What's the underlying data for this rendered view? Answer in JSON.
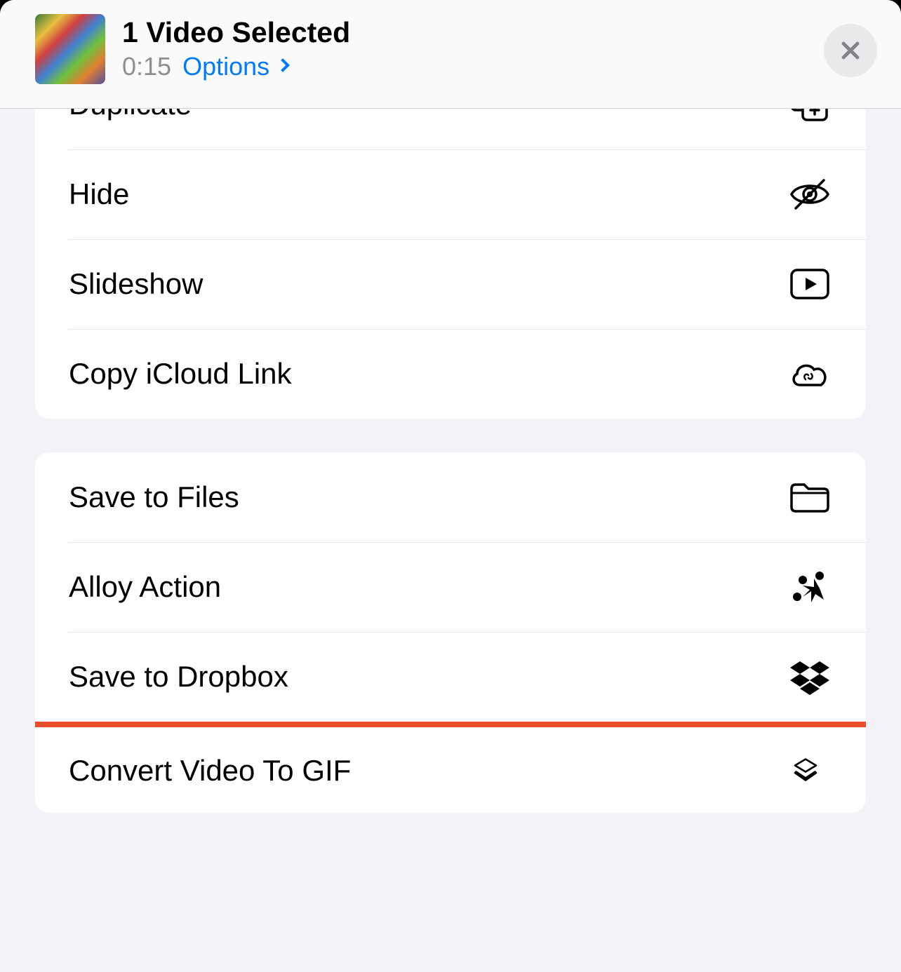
{
  "header": {
    "title": "1 Video Selected",
    "duration": "0:15",
    "options_label": "Options"
  },
  "group1": {
    "duplicate": "Duplicate",
    "hide": "Hide",
    "slideshow": "Slideshow",
    "copy_icloud": "Copy iCloud Link"
  },
  "group2": {
    "save_files": "Save to Files",
    "alloy": "Alloy Action",
    "dropbox": "Save to Dropbox",
    "convert_gif": "Convert Video To GIF"
  }
}
